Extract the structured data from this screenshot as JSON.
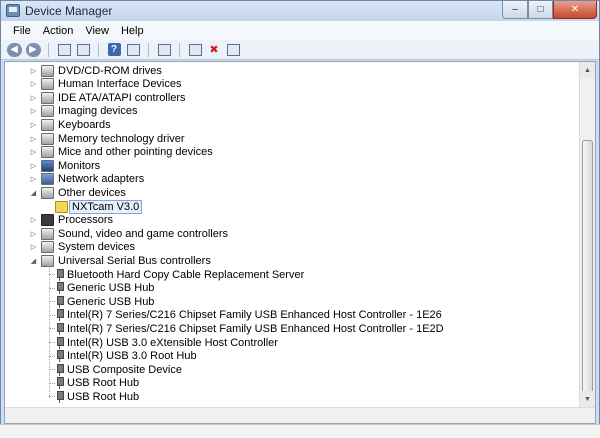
{
  "window": {
    "title": "Device Manager",
    "controls": {
      "minimize": "–",
      "maximize": "□",
      "close": "✕"
    }
  },
  "menubar": {
    "items": [
      "File",
      "Action",
      "View",
      "Help"
    ]
  },
  "toolbar": {
    "buttons": [
      "back-icon",
      "forward-icon",
      "show-hide-console-tree-icon",
      "properties-icon",
      "help-icon",
      "update-driver-icon",
      "scan-hardware-icon",
      "disable-device-icon",
      "uninstall-device-icon"
    ]
  },
  "tree": {
    "nodes": [
      {
        "label": "DVD/CD-ROM drives",
        "expander": "▷",
        "icon": "dvd-drive-icon"
      },
      {
        "label": "Human Interface Devices",
        "expander": "▷",
        "icon": "hid-icon"
      },
      {
        "label": "IDE ATA/ATAPI controllers",
        "expander": "▷",
        "icon": "ide-controller-icon"
      },
      {
        "label": "Imaging devices",
        "expander": "▷",
        "icon": "camera-icon"
      },
      {
        "label": "Keyboards",
        "expander": "▷",
        "icon": "keyboard-icon"
      },
      {
        "label": "Memory technology driver",
        "expander": "▷",
        "icon": "memory-icon"
      },
      {
        "label": "Mice and other pointing devices",
        "expander": "▷",
        "icon": "mouse-icon"
      },
      {
        "label": "Monitors",
        "expander": "▷",
        "icon": "monitor-icon"
      },
      {
        "label": "Network adapters",
        "expander": "▷",
        "icon": "network-adapter-icon"
      },
      {
        "label": "Other devices",
        "expander": "◢",
        "icon": "unknown-device-icon"
      },
      {
        "label": "NXTcam V3.0",
        "child": true,
        "selected": true,
        "icon": "warning-device-icon"
      },
      {
        "label": "Processors",
        "expander": "▷",
        "icon": "processor-icon"
      },
      {
        "label": "Sound, video and game controllers",
        "expander": "▷",
        "icon": "sound-icon"
      },
      {
        "label": "System devices",
        "expander": "▷",
        "icon": "system-device-icon"
      },
      {
        "label": "Universal Serial Bus controllers",
        "expander": "◢",
        "icon": "usb-controller-icon"
      }
    ],
    "usb_children": [
      "Bluetooth Hard Copy Cable Replacement Server",
      "Generic USB Hub",
      "Generic USB Hub",
      "Intel(R) 7 Series/C216 Chipset Family USB Enhanced Host Controller - 1E26",
      "Intel(R) 7 Series/C216 Chipset Family USB Enhanced Host Controller - 1E2D",
      "Intel(R) USB 3.0 eXtensible Host Controller",
      "Intel(R) USB 3.0 Root Hub",
      "USB Composite Device",
      "USB Root Hub",
      "USB Root Hub"
    ]
  },
  "scrollbar": {
    "up": "▲",
    "down": "▼",
    "position": 0.75
  }
}
